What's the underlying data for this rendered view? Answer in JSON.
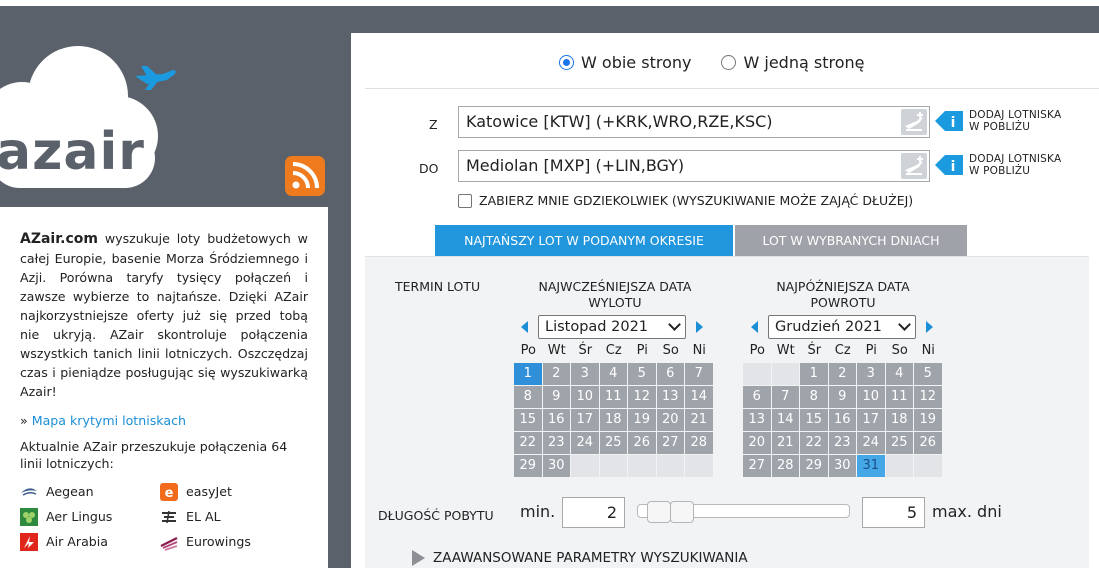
{
  "brand": {
    "logo_text": "azair",
    "rss_icon": "rss-icon"
  },
  "sidebar": {
    "brand_name": "AZair.com",
    "about_text": " wyszukuje loty budżetowych w całej Europie, basenie Morza Śródziemnego i Azji. Porówna taryfy tysięcy połączeń i zawsze wybierze to najtańsze. Dzięki AZair najkorzystniejsze oferty już się przed tobą nie ukryją. AZair skontroluje połączenia wszystkich tanich linii lotniczych. Oszczędzaj czas i pieniądze posługując się wyszukiwarką Azair!",
    "map_prefix": "» ",
    "map_link": "Mapa krytymi lotniskach",
    "updates_text": "Aktualnie AZair przeszukuje połączenia 64 linii lotniczych:",
    "airlines": [
      {
        "name": "Aegean",
        "icon": "aegean-icon",
        "color": "#3a5a8c"
      },
      {
        "name": "easyJet",
        "icon": "easyjet-icon",
        "color": "#f26b1d"
      },
      {
        "name": "Aer Lingus",
        "icon": "aer-lingus-icon",
        "color": "#2e8b3e"
      },
      {
        "name": "EL AL",
        "icon": "el-al-icon",
        "color": "#333333"
      },
      {
        "name": "Air Arabia",
        "icon": "air-arabia-icon",
        "color": "#e0261b"
      },
      {
        "name": "Eurowings",
        "icon": "eurowings-icon",
        "color": "#8b1b4f"
      }
    ]
  },
  "search": {
    "trip_types": [
      {
        "label": "W obie strony",
        "selected": true
      },
      {
        "label": "W jedną stronę",
        "selected": false
      }
    ],
    "from_label": "Z",
    "from_value": "Katowice [KTW] (+KRK,WRO,RZE,KSC)",
    "to_label": "DO",
    "to_value": "Mediolan [MXP] (+LIN,BGY)",
    "nearby_line1": "DODAJ LOTNISKA",
    "nearby_line2": "W POBLIŻU",
    "anywhere_label": "ZABIERZ MNIE GDZIEKOLWIEK (WYSZUKIWANIE MOŻE ZAJĄĆ DŁUŻEJ)",
    "tab_active": "NAJTAŃSZY LOT W PODANYM OKRESIE",
    "tab_inactive": "LOT W WYBRANYCH DNIACH"
  },
  "calendars": {
    "term_label": "TERMIN LOTU",
    "weekdays": [
      "Po",
      "Wt",
      "Śr",
      "Cz",
      "Pi",
      "So",
      "Ni"
    ],
    "departure": {
      "title_line1": "NAJWCZEŚNIEJSZA DATA",
      "title_line2": "WYLOTU",
      "month": "Listopad 2021",
      "offset": 0,
      "days": 30,
      "selected_day": 1
    },
    "return": {
      "title_line1": "NAJPÓŹNIEJSZA DATA",
      "title_line2": "POWROTU",
      "month": "Grudzień 2021",
      "offset": 2,
      "days": 31,
      "selected_day": 31
    }
  },
  "stay": {
    "label": "DŁUGOŚĆ POBYTU",
    "min_label": "min.",
    "min_value": "2",
    "max_value": "5",
    "max_label": "max. dni"
  },
  "advanced_label": "ZAAWANSOWANE PARAMETRY WYSZUKIWANIA"
}
